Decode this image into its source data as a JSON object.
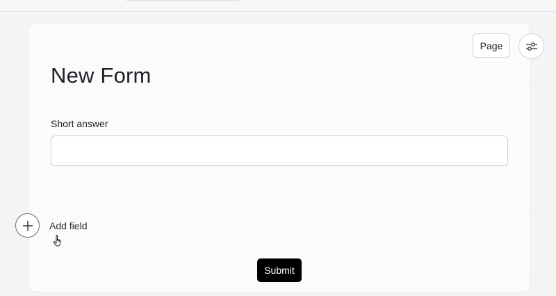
{
  "toolbar": {
    "page_label": "Page",
    "settings_icon": "sliders-icon"
  },
  "form": {
    "title": "New Form",
    "fields": [
      {
        "label": "Short answer",
        "value": "",
        "placeholder": ""
      }
    ],
    "add_field_label": "Add field",
    "add_field_icon": "plus-icon",
    "submit_label": "Submit"
  },
  "colors": {
    "submit_bg": "#000000",
    "card_bg": "#fbfbfc"
  }
}
